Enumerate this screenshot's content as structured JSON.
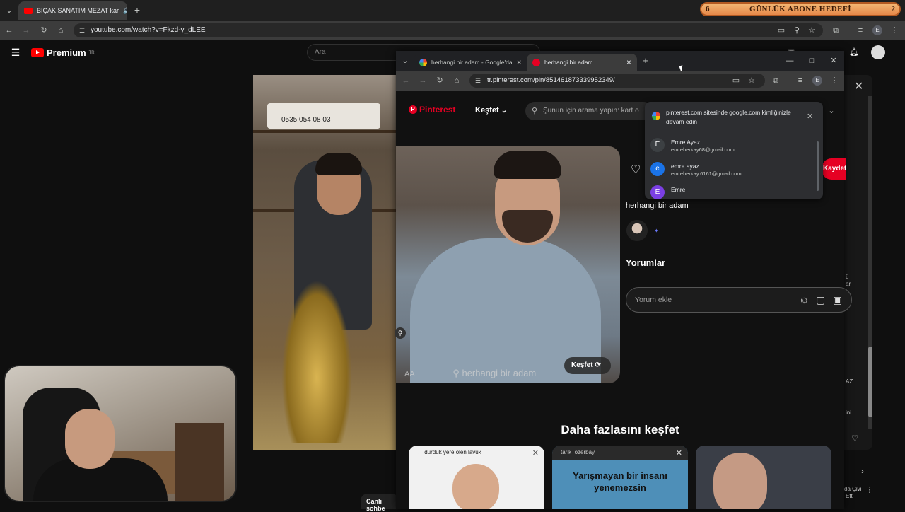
{
  "outer_browser": {
    "tab_title": "BIÇAK SANATIM MEZAT kar",
    "url": "youtube.com/watch?v=Fkzd-y_dLEE"
  },
  "banner": {
    "left_number": "6",
    "title": "GÜNLÜK ABONE HEDEFİ",
    "right_number": "2"
  },
  "youtube": {
    "logo_text": "Premium",
    "logo_badge": "TR",
    "search_placeholder": "Ara",
    "video_sign": "0535 054 08 03",
    "live_chat": "Canlı sohbe",
    "side_texts": [
      "ü",
      "ar",
      "AZ",
      "ini",
      "da Çivi",
      "Etti"
    ]
  },
  "inner_browser": {
    "tab1_title": "herhangi bir adam - Google'da",
    "tab2_title": "herhangi bir adam",
    "url": "tr.pinterest.com/pin/851461873339952349/"
  },
  "pinterest": {
    "logo": "Pinterest",
    "explore_nav": "Keşfet",
    "search_placeholder": "Şunun için arama yapın: kart o",
    "image_search_text": "herhangi bir adam",
    "explore_button": "Keşfet",
    "save_button": "Kaydet",
    "pin_title": "herhangi bir adam",
    "comments_heading": "Yorumlar",
    "comment_placeholder": "Yorum ekle",
    "more_heading": "Daha fazlasını keşfet",
    "cards": [
      {
        "header": "durduk yere ölen lavuk"
      },
      {
        "header": "tarik_ozerbay",
        "text": "Yarışmayan bir insanı yenemezsin"
      },
      {
        "header": ""
      }
    ]
  },
  "google_popup": {
    "message": "pinterest.com sitesinde google.com kimliğinizle devam edin",
    "accounts": [
      {
        "initial": "E",
        "name": "Emre Ayaz",
        "email": "emreberkay68@gmail.com",
        "color": "#3c4043"
      },
      {
        "initial": "e",
        "name": "emre ayaz",
        "email": "emreberkay.6161@gmail.com",
        "color": "#1a73e8"
      },
      {
        "initial": "E",
        "name": "Emre",
        "email": "",
        "color": "#7b3fe4"
      }
    ]
  }
}
